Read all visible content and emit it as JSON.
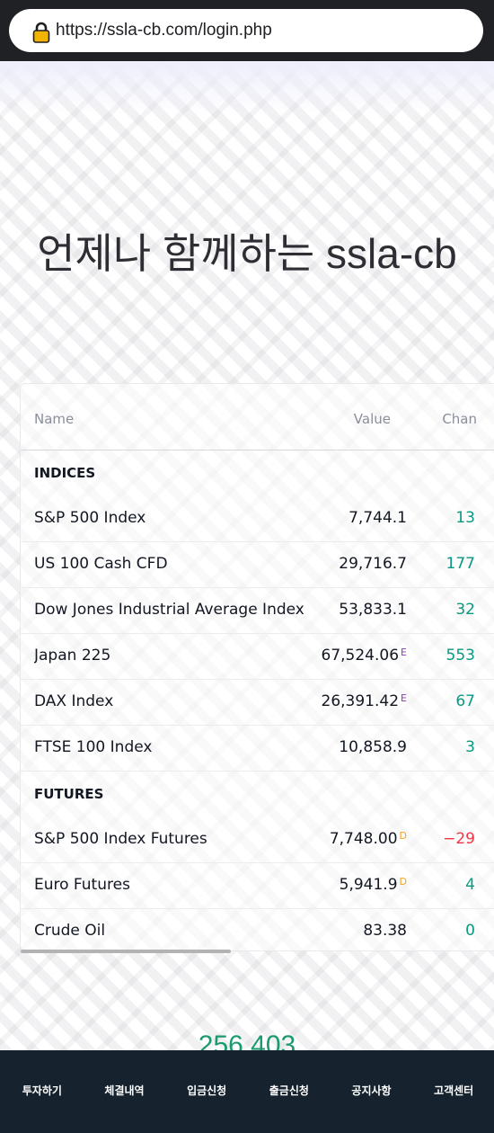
{
  "browser": {
    "url": "https://ssla-cb.com/login.php",
    "lock_icon": "lock-icon"
  },
  "hero": {
    "title": "언제나 함께하는 ssla-cb"
  },
  "widget": {
    "headers": {
      "name": "Name",
      "value": "Value",
      "change": "Chan"
    },
    "positive_color": "#089981",
    "negative_color": "#f23645",
    "rows": [
      {
        "type": "section",
        "label": "INDICES"
      },
      {
        "type": "item",
        "name": "S&P 500 Index",
        "value": "7,744.1",
        "flag": "",
        "change": "13",
        "trend": "up"
      },
      {
        "type": "item",
        "name": "US 100 Cash CFD",
        "value": "29,716.7",
        "flag": "",
        "change": "177",
        "trend": "up"
      },
      {
        "type": "item",
        "name": "Dow Jones Industrial Average Index",
        "value": "53,833.1",
        "flag": "",
        "change": "32",
        "trend": "up"
      },
      {
        "type": "item",
        "name": "Japan 225",
        "value": "67,524.06",
        "flag": "E",
        "change": "553",
        "trend": "up"
      },
      {
        "type": "item",
        "name": "DAX Index",
        "value": "26,391.42",
        "flag": "E",
        "change": "67",
        "trend": "up"
      },
      {
        "type": "item",
        "name": "FTSE 100 Index",
        "value": "10,858.9",
        "flag": "",
        "change": "3",
        "trend": "up"
      },
      {
        "type": "section",
        "label": "FUTURES"
      },
      {
        "type": "item",
        "name": "S&P 500 Index Futures",
        "value": "7,748.00",
        "flag": "D",
        "change": "−29",
        "trend": "down"
      },
      {
        "type": "item",
        "name": "Euro Futures",
        "value": "5,941.9",
        "flag": "D",
        "change": "4",
        "trend": "up"
      },
      {
        "type": "item",
        "name": "Crude Oil",
        "value": "83.38",
        "flag": "",
        "change": "0",
        "trend": "up"
      }
    ]
  },
  "ticker": {
    "value": "256,403"
  },
  "bottom_nav": {
    "items": [
      "투자하기",
      "체결내역",
      "입금신청",
      "출금신청",
      "공지사항",
      "고객센터"
    ]
  }
}
